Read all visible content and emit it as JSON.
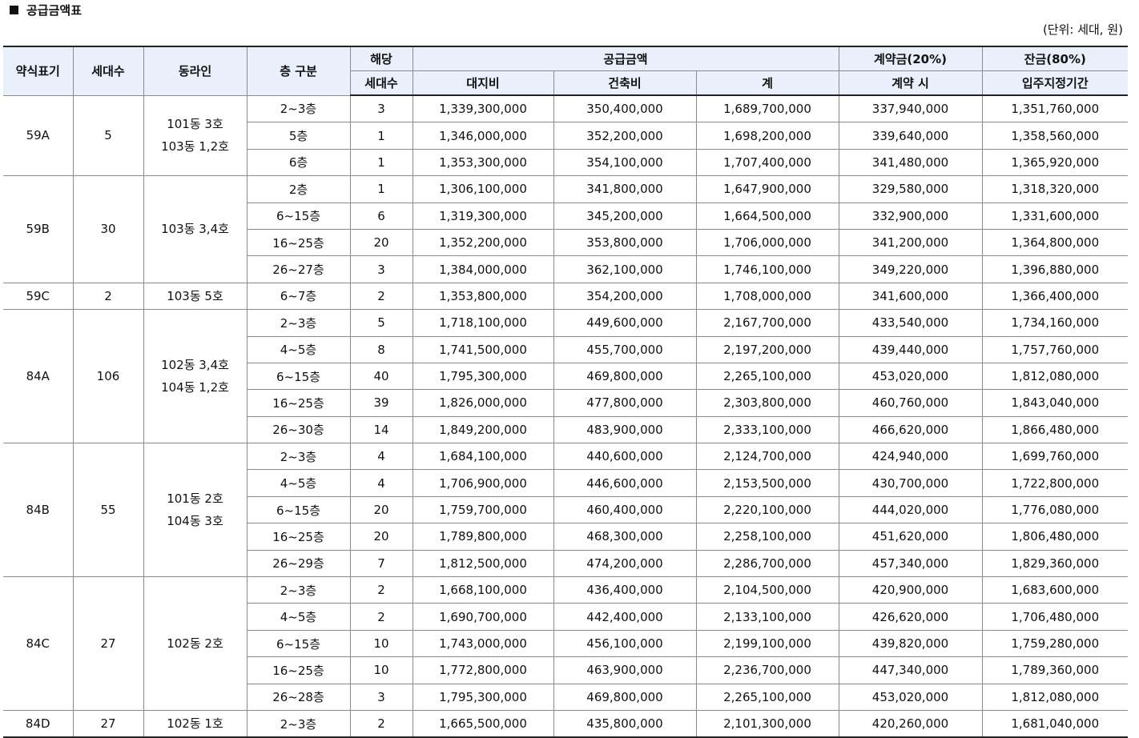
{
  "title": "공급금액표",
  "unit_note": "(단위: 세대, 원)",
  "headers": {
    "type_abbr": "약식표기",
    "households": "세대수",
    "building_line": "동라인",
    "floor_division": "층 구분",
    "applicable_households_1": "해당",
    "applicable_households_2": "세대수",
    "supply_amount": "공급금액",
    "land_cost": "대지비",
    "construction_cost": "건축비",
    "total": "계",
    "deposit": "계약금(20%)",
    "deposit_sub": "계약 시",
    "balance": "잔금(80%)",
    "balance_sub": "입주지정기간"
  },
  "groups": [
    {
      "type": "59A",
      "households": "5",
      "lines": [
        "101동 3호",
        "103동 1,2호"
      ],
      "rows": [
        {
          "floor": "2~3층",
          "count": "3",
          "land": "1,339,300,000",
          "build": "350,400,000",
          "total": "1,689,700,000",
          "deposit": "337,940,000",
          "balance": "1,351,760,000"
        },
        {
          "floor": "5층",
          "count": "1",
          "land": "1,346,000,000",
          "build": "352,200,000",
          "total": "1,698,200,000",
          "deposit": "339,640,000",
          "balance": "1,358,560,000"
        },
        {
          "floor": "6층",
          "count": "1",
          "land": "1,353,300,000",
          "build": "354,100,000",
          "total": "1,707,400,000",
          "deposit": "341,480,000",
          "balance": "1,365,920,000"
        }
      ]
    },
    {
      "type": "59B",
      "households": "30",
      "lines": [
        "103동 3,4호"
      ],
      "rows": [
        {
          "floor": "2층",
          "count": "1",
          "land": "1,306,100,000",
          "build": "341,800,000",
          "total": "1,647,900,000",
          "deposit": "329,580,000",
          "balance": "1,318,320,000"
        },
        {
          "floor": "6~15층",
          "count": "6",
          "land": "1,319,300,000",
          "build": "345,200,000",
          "total": "1,664,500,000",
          "deposit": "332,900,000",
          "balance": "1,331,600,000"
        },
        {
          "floor": "16~25층",
          "count": "20",
          "land": "1,352,200,000",
          "build": "353,800,000",
          "total": "1,706,000,000",
          "deposit": "341,200,000",
          "balance": "1,364,800,000"
        },
        {
          "floor": "26~27층",
          "count": "3",
          "land": "1,384,000,000",
          "build": "362,100,000",
          "total": "1,746,100,000",
          "deposit": "349,220,000",
          "balance": "1,396,880,000"
        }
      ]
    },
    {
      "type": "59C",
      "households": "2",
      "lines": [
        "103동 5호"
      ],
      "rows": [
        {
          "floor": "6~7층",
          "count": "2",
          "land": "1,353,800,000",
          "build": "354,200,000",
          "total": "1,708,000,000",
          "deposit": "341,600,000",
          "balance": "1,366,400,000"
        }
      ]
    },
    {
      "type": "84A",
      "households": "106",
      "lines": [
        "102동 3,4호",
        "104동 1,2호"
      ],
      "rows": [
        {
          "floor": "2~3층",
          "count": "5",
          "land": "1,718,100,000",
          "build": "449,600,000",
          "total": "2,167,700,000",
          "deposit": "433,540,000",
          "balance": "1,734,160,000"
        },
        {
          "floor": "4~5층",
          "count": "8",
          "land": "1,741,500,000",
          "build": "455,700,000",
          "total": "2,197,200,000",
          "deposit": "439,440,000",
          "balance": "1,757,760,000"
        },
        {
          "floor": "6~15층",
          "count": "40",
          "land": "1,795,300,000",
          "build": "469,800,000",
          "total": "2,265,100,000",
          "deposit": "453,020,000",
          "balance": "1,812,080,000"
        },
        {
          "floor": "16~25층",
          "count": "39",
          "land": "1,826,000,000",
          "build": "477,800,000",
          "total": "2,303,800,000",
          "deposit": "460,760,000",
          "balance": "1,843,040,000"
        },
        {
          "floor": "26~30층",
          "count": "14",
          "land": "1,849,200,000",
          "build": "483,900,000",
          "total": "2,333,100,000",
          "deposit": "466,620,000",
          "balance": "1,866,480,000"
        }
      ]
    },
    {
      "type": "84B",
      "households": "55",
      "lines": [
        "101동 2호",
        "104동 3호"
      ],
      "rows": [
        {
          "floor": "2~3층",
          "count": "4",
          "land": "1,684,100,000",
          "build": "440,600,000",
          "total": "2,124,700,000",
          "deposit": "424,940,000",
          "balance": "1,699,760,000"
        },
        {
          "floor": "4~5층",
          "count": "4",
          "land": "1,706,900,000",
          "build": "446,600,000",
          "total": "2,153,500,000",
          "deposit": "430,700,000",
          "balance": "1,722,800,000"
        },
        {
          "floor": "6~15층",
          "count": "20",
          "land": "1,759,700,000",
          "build": "460,400,000",
          "total": "2,220,100,000",
          "deposit": "444,020,000",
          "balance": "1,776,080,000"
        },
        {
          "floor": "16~25층",
          "count": "20",
          "land": "1,789,800,000",
          "build": "468,300,000",
          "total": "2,258,100,000",
          "deposit": "451,620,000",
          "balance": "1,806,480,000"
        },
        {
          "floor": "26~29층",
          "count": "7",
          "land": "1,812,500,000",
          "build": "474,200,000",
          "total": "2,286,700,000",
          "deposit": "457,340,000",
          "balance": "1,829,360,000"
        }
      ]
    },
    {
      "type": "84C",
      "households": "27",
      "lines": [
        "102동 2호"
      ],
      "rows": [
        {
          "floor": "2~3층",
          "count": "2",
          "land": "1,668,100,000",
          "build": "436,400,000",
          "total": "2,104,500,000",
          "deposit": "420,900,000",
          "balance": "1,683,600,000"
        },
        {
          "floor": "4~5층",
          "count": "2",
          "land": "1,690,700,000",
          "build": "442,400,000",
          "total": "2,133,100,000",
          "deposit": "426,620,000",
          "balance": "1,706,480,000"
        },
        {
          "floor": "6~15층",
          "count": "10",
          "land": "1,743,000,000",
          "build": "456,100,000",
          "total": "2,199,100,000",
          "deposit": "439,820,000",
          "balance": "1,759,280,000"
        },
        {
          "floor": "16~25층",
          "count": "10",
          "land": "1,772,800,000",
          "build": "463,900,000",
          "total": "2,236,700,000",
          "deposit": "447,340,000",
          "balance": "1,789,360,000"
        },
        {
          "floor": "26~28층",
          "count": "3",
          "land": "1,795,300,000",
          "build": "469,800,000",
          "total": "2,265,100,000",
          "deposit": "453,020,000",
          "balance": "1,812,080,000"
        }
      ]
    },
    {
      "type": "84D",
      "households": "27",
      "lines": [
        "102동 1호"
      ],
      "rows": [
        {
          "floor": "2~3층",
          "count": "2",
          "land": "1,665,500,000",
          "build": "435,800,000",
          "total": "2,101,300,000",
          "deposit": "420,260,000",
          "balance": "1,681,040,000"
        }
      ]
    }
  ]
}
